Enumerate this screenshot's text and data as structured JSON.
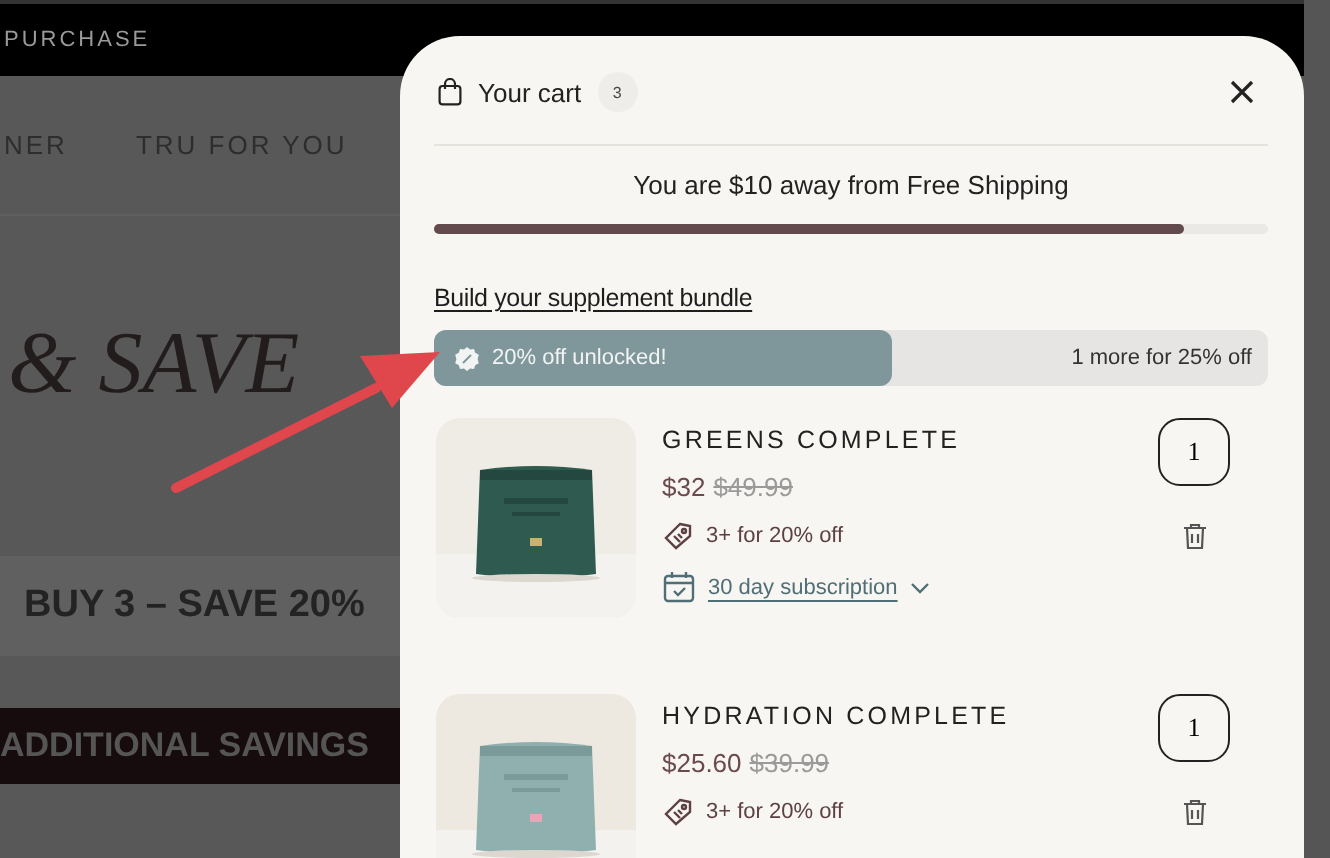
{
  "background_page": {
    "top_bar": "PURCHASE",
    "nav": [
      "NER",
      "TRU FOR YOU"
    ],
    "hero_title": "& SAVE",
    "promo_banner": "BUY 3 – SAVE 20%",
    "savings_bar": "ADDITIONAL SAVINGS"
  },
  "cart": {
    "title": "Your cart",
    "count": "3",
    "shipping_message": "You are $10 away from Free Shipping",
    "shipping_progress": {
      "level": 0.9
    },
    "bundle_title": "Build your supplement bundle",
    "bundle_progress": {
      "level": 0.55,
      "unlocked_text": "20% off unlocked!",
      "next_text": "1 more for 25% off"
    },
    "items": [
      {
        "name": "GREENS COMPLETE",
        "price": "$32",
        "original_price": "$49.99",
        "offer": "3+ for 20% off",
        "subscription": "30 day subscription",
        "quantity": "1"
      },
      {
        "name": "HYDRATION COMPLETE",
        "price": "$25.60",
        "original_price": "$39.99",
        "offer": "3+ for 20% off",
        "quantity": "1"
      }
    ]
  }
}
